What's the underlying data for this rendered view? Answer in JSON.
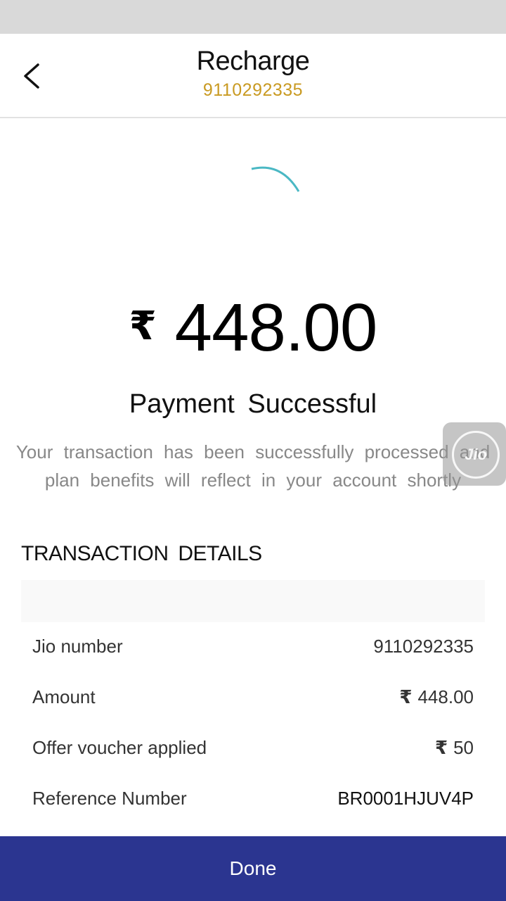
{
  "header": {
    "title": "Recharge",
    "subtitle": "9110292335"
  },
  "amount": {
    "currency_symbol": "₹",
    "value": "448.00"
  },
  "status": {
    "title": "Payment Successful",
    "message": "Your transaction has been successfully processed and plan benefits will reflect in your account shortly"
  },
  "jio_bubble": {
    "label": "Jio"
  },
  "transaction": {
    "section_title": "TRANSACTION DETAILS",
    "rows": [
      {
        "label": "Jio number",
        "value": "9110292335"
      },
      {
        "label": "Amount",
        "currency": "₹",
        "value": "448.00"
      },
      {
        "label": "Offer voucher applied",
        "currency": "₹",
        "value": "50"
      },
      {
        "label": "Reference Number",
        "value": "BR0001HJUV4P"
      }
    ]
  },
  "footer": {
    "done_label": "Done"
  },
  "colors": {
    "accent_gold": "#c99a22",
    "primary_button": "#2b3590",
    "spinner": "#4ab8c4"
  }
}
